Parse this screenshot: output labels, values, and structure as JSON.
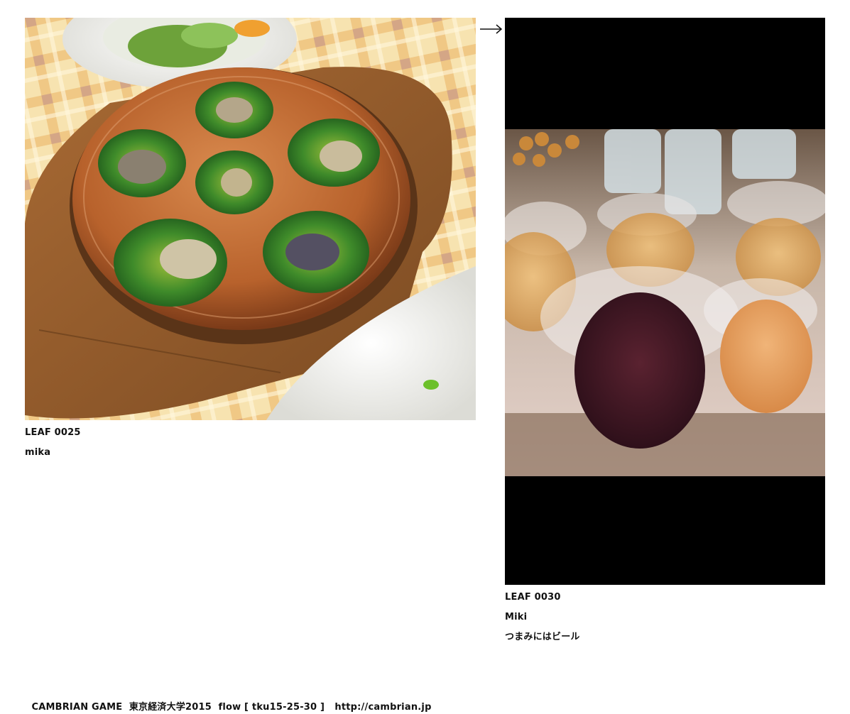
{
  "leaves": [
    {
      "id_label": "LEAF 0025",
      "author": "mika",
      "comment": "",
      "photo_subject": "escargot-dish-photo"
    },
    {
      "id_label": "LEAF 0030",
      "author": "Miki",
      "comment": "つまみにはビール",
      "photo_subject": "beer-cups-photo"
    }
  ],
  "nav": {
    "arrow_glyph": "→",
    "arrow_icon": "right-arrow-icon"
  },
  "footer": {
    "site_name": "CAMBRIAN GAME",
    "event": "東京経済大学2015",
    "flow_label": "flow [ tku15-25-30 ]",
    "url": "http://cambrian.jp"
  }
}
